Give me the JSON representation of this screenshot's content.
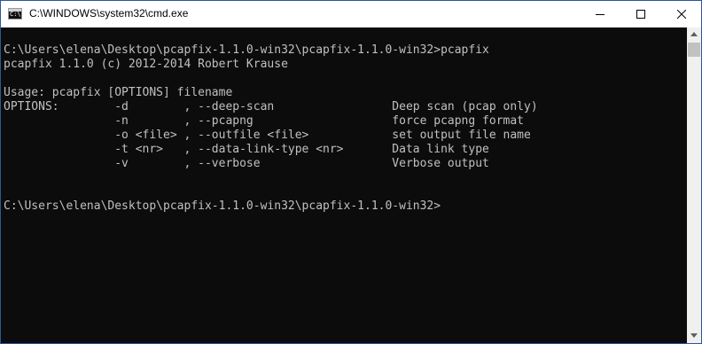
{
  "window": {
    "title": "C:\\WINDOWS\\system32\\cmd.exe",
    "app_icon": "cmd-icon",
    "app_icon_text": "C:\\",
    "controls": [
      "minimize-icon",
      "maximize-icon",
      "close-icon"
    ]
  },
  "console": {
    "lines": [
      "",
      "C:\\Users\\elena\\Desktop\\pcapfix-1.1.0-win32\\pcapfix-1.1.0-win32>pcapfix",
      "pcapfix 1.1.0 (c) 2012-2014 Robert Krause",
      "",
      "Usage: pcapfix [OPTIONS] filename",
      "OPTIONS:        -d        , --deep-scan                 Deep scan (pcap only)",
      "                -n        , --pcapng                    force pcapng format",
      "                -o <file> , --outfile <file>            set output file name",
      "                -t <nr>   , --data-link-type <nr>       Data link type",
      "                -v        , --verbose                   Verbose output",
      "",
      "",
      "C:\\Users\\elena\\Desktop\\pcapfix-1.1.0-win32\\pcapfix-1.1.0-win32>"
    ],
    "background": "#0c0c0c",
    "foreground": "#c0c0c0"
  },
  "scrollbar": {
    "up_icon": "scroll-up-arrow-icon",
    "down_icon": "scroll-down-arrow-icon"
  }
}
